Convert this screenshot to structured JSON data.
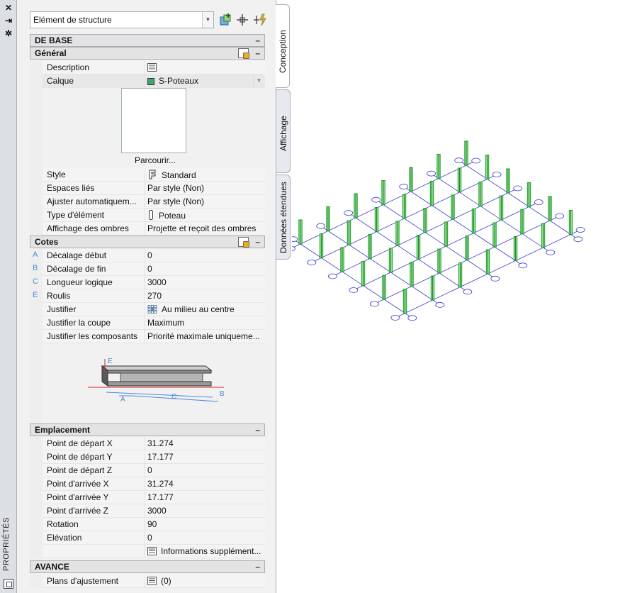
{
  "window": {
    "title": "PROPRIÉTÉS",
    "controls": [
      "close-icon",
      "autohide-icon",
      "settings-icon"
    ]
  },
  "toolbar": {
    "type_selector": "Elément de structure",
    "icons": [
      "add-selection-icon",
      "select-objects-icon",
      "quick-select-icon"
    ]
  },
  "tabs": [
    {
      "label": "Conception",
      "active": true
    },
    {
      "label": "Affichage",
      "active": false
    },
    {
      "label": "Données étendues",
      "active": false
    }
  ],
  "sections": {
    "base": "DE BASE",
    "general": "Général",
    "cotes": "Cotes",
    "emplacement": "Emplacement",
    "avance": "AVANCE",
    "collapse_symbol": "–"
  },
  "general": {
    "description": {
      "key": "Description",
      "value": ""
    },
    "calque": {
      "key": "Calque",
      "value": "S-Poteaux",
      "swatch": "#3aa86a"
    },
    "browse": "Parcourir...",
    "style": {
      "key": "Style",
      "value": "Standard"
    },
    "espaces": {
      "key": "Espaces liés",
      "value": "Par style (Non)"
    },
    "ajuster": {
      "key": "Ajuster  automatiquem...",
      "value": "Par style (Non)"
    },
    "type": {
      "key": "Type d'élément",
      "value": "Poteau"
    },
    "ombres": {
      "key": "Affichage des ombres",
      "value": "Projette et reçoit des ombres"
    }
  },
  "cotes": {
    "rows": [
      {
        "letter": "A",
        "key": "Décalage début",
        "value": "0"
      },
      {
        "letter": "B",
        "key": "Décalage de fin",
        "value": "0"
      },
      {
        "letter": "C",
        "key": "Longueur logique",
        "value": "3000"
      },
      {
        "letter": "E",
        "key": "Roulis",
        "value": "270"
      },
      {
        "letter": "",
        "key": "Justifier",
        "value": "Au milieu au centre"
      },
      {
        "letter": "",
        "key": "Justifier la coupe",
        "value": "Maximum"
      },
      {
        "letter": "",
        "key": "Justifier les composants",
        "value": "Priorité  maximale  uniqueme..."
      }
    ],
    "diagram_labels": {
      "e": "E",
      "a": "A",
      "c": "C",
      "b": "B"
    }
  },
  "emplacement": {
    "rows": [
      {
        "key": "Point de départ X",
        "value": "31.274"
      },
      {
        "key": "Point de départ Y",
        "value": "17.177"
      },
      {
        "key": "Point de départ Z",
        "value": "0"
      },
      {
        "key": "Point d'arrivée X",
        "value": "31.274"
      },
      {
        "key": "Point d'arrivée Y",
        "value": "17.177"
      },
      {
        "key": "Point d'arrivée Z",
        "value": "3000"
      },
      {
        "key": "Rotation",
        "value": "90"
      },
      {
        "key": "Elévation",
        "value": "0"
      }
    ],
    "info": "Informations  supplément..."
  },
  "avance": {
    "plans": {
      "key": "Plans d'ajustement",
      "value": "(0)"
    }
  },
  "colors": {
    "grid_line": "#3b3bd6",
    "column": "#1f9e2a",
    "label_accent": "#4a8ad8"
  }
}
